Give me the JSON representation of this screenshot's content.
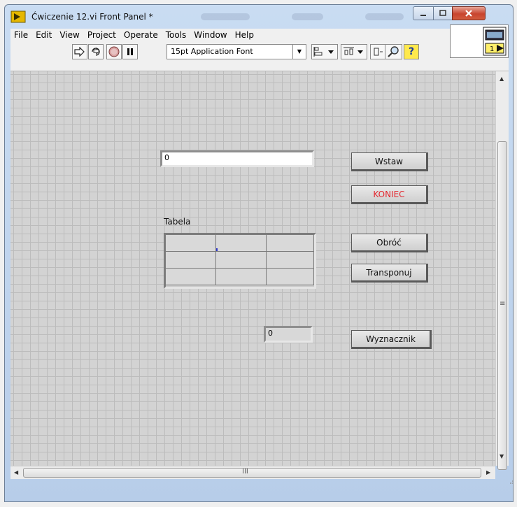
{
  "window": {
    "title": "Ćwiczenie 12.vi Front Panel *"
  },
  "menu": {
    "items": [
      "File",
      "Edit",
      "View",
      "Project",
      "Operate",
      "Tools",
      "Window",
      "Help"
    ]
  },
  "toolbar": {
    "font": "15pt Application Font",
    "icons": [
      "run-arrow-icon",
      "run-continuous-icon",
      "abort-icon",
      "pause-icon",
      "align-icon",
      "distribute-icon",
      "resize-icon",
      "search-icon",
      "help-icon"
    ]
  },
  "panel": {
    "input_value": "0",
    "table_label": "Tabela",
    "result_value": "0",
    "buttons": {
      "wstaw": "Wstaw",
      "koniec": "KONIEC",
      "obroc": "Obróć",
      "transponuj": "Transponuj",
      "wyznacznik": "Wyznacznik"
    }
  },
  "colors": {
    "koniec_text": "#e3262e",
    "panel_bg": "#d3d3d3",
    "grid_line": "#bcbcbc"
  },
  "scroll": {
    "hscroll_grip": "III",
    "vscroll_grip": "≡"
  }
}
